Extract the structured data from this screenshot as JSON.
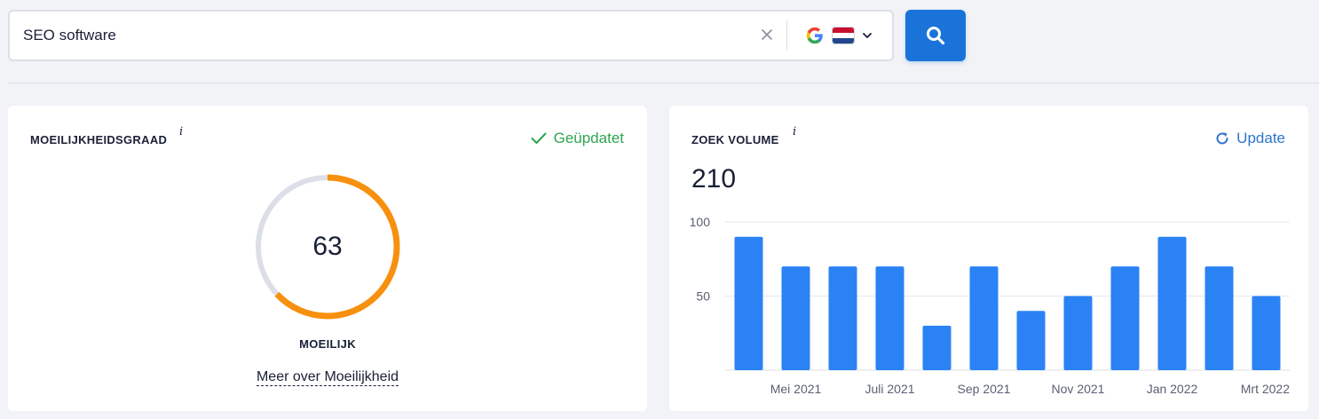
{
  "search": {
    "query": "SEO software",
    "engine": "google-icon",
    "country": "netherlands-flag-icon"
  },
  "difficulty": {
    "title": "MOEILIJKHEIDSGRAAD",
    "info": "i",
    "status": "Geüpdatet",
    "value": 63,
    "display_value": "63",
    "label": "MOEILIJK",
    "more_link": "Meer over Moeilijkheid",
    "color": "#f7900e"
  },
  "volume": {
    "title": "ZOEK VOLUME",
    "info": "i",
    "action": "Update",
    "value": "210"
  },
  "chart_data": {
    "type": "bar",
    "categories": [
      "",
      "Mei 2021",
      "",
      "Juli 2021",
      "",
      "Sep 2021",
      "",
      "Nov 2021",
      "",
      "Jan 2022",
      "",
      "Mrt 2022"
    ],
    "values": [
      90,
      70,
      70,
      70,
      30,
      70,
      40,
      50,
      70,
      90,
      70,
      50
    ],
    "title": "",
    "xlabel": "",
    "ylabel": "",
    "ylim": [
      0,
      100
    ],
    "yticks": [
      100,
      50
    ],
    "ytick_labels": [
      "100",
      "50"
    ],
    "grid": true,
    "color": "#2a82f5"
  },
  "colors": {
    "accent": "#1a73d9",
    "success": "#2ea44f",
    "link": "#2f74cc",
    "gauge_track": "#dcdfe7"
  }
}
